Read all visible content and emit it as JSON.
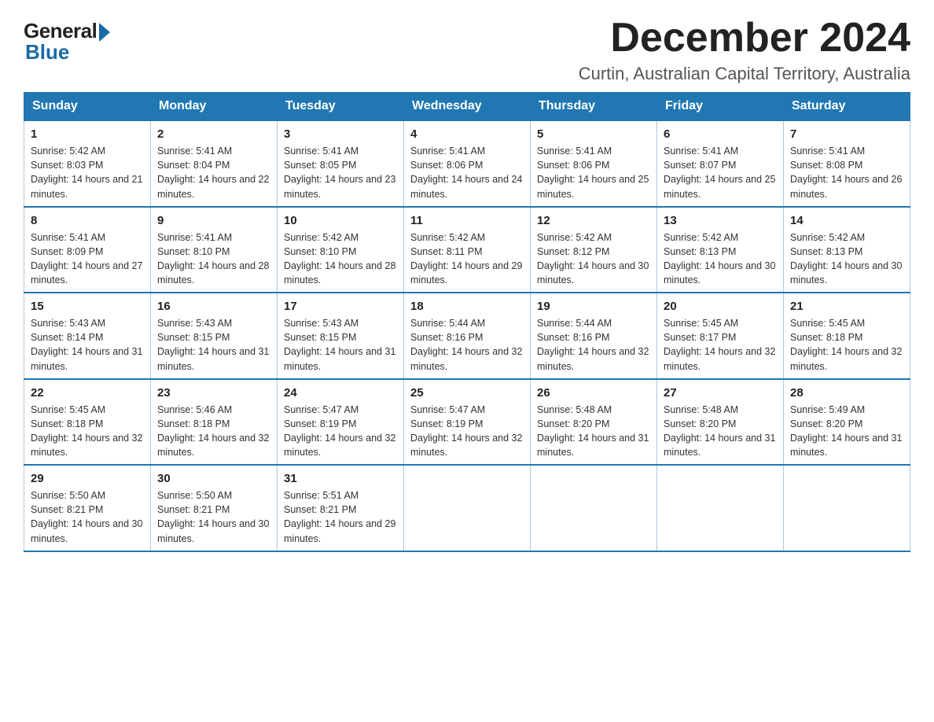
{
  "header": {
    "logo_general": "General",
    "logo_blue": "Blue",
    "month_title": "December 2024",
    "location": "Curtin, Australian Capital Territory, Australia"
  },
  "columns": [
    "Sunday",
    "Monday",
    "Tuesday",
    "Wednesday",
    "Thursday",
    "Friday",
    "Saturday"
  ],
  "weeks": [
    [
      {
        "day": "1",
        "sunrise": "Sunrise: 5:42 AM",
        "sunset": "Sunset: 8:03 PM",
        "daylight": "Daylight: 14 hours and 21 minutes."
      },
      {
        "day": "2",
        "sunrise": "Sunrise: 5:41 AM",
        "sunset": "Sunset: 8:04 PM",
        "daylight": "Daylight: 14 hours and 22 minutes."
      },
      {
        "day": "3",
        "sunrise": "Sunrise: 5:41 AM",
        "sunset": "Sunset: 8:05 PM",
        "daylight": "Daylight: 14 hours and 23 minutes."
      },
      {
        "day": "4",
        "sunrise": "Sunrise: 5:41 AM",
        "sunset": "Sunset: 8:06 PM",
        "daylight": "Daylight: 14 hours and 24 minutes."
      },
      {
        "day": "5",
        "sunrise": "Sunrise: 5:41 AM",
        "sunset": "Sunset: 8:06 PM",
        "daylight": "Daylight: 14 hours and 25 minutes."
      },
      {
        "day": "6",
        "sunrise": "Sunrise: 5:41 AM",
        "sunset": "Sunset: 8:07 PM",
        "daylight": "Daylight: 14 hours and 25 minutes."
      },
      {
        "day": "7",
        "sunrise": "Sunrise: 5:41 AM",
        "sunset": "Sunset: 8:08 PM",
        "daylight": "Daylight: 14 hours and 26 minutes."
      }
    ],
    [
      {
        "day": "8",
        "sunrise": "Sunrise: 5:41 AM",
        "sunset": "Sunset: 8:09 PM",
        "daylight": "Daylight: 14 hours and 27 minutes."
      },
      {
        "day": "9",
        "sunrise": "Sunrise: 5:41 AM",
        "sunset": "Sunset: 8:10 PM",
        "daylight": "Daylight: 14 hours and 28 minutes."
      },
      {
        "day": "10",
        "sunrise": "Sunrise: 5:42 AM",
        "sunset": "Sunset: 8:10 PM",
        "daylight": "Daylight: 14 hours and 28 minutes."
      },
      {
        "day": "11",
        "sunrise": "Sunrise: 5:42 AM",
        "sunset": "Sunset: 8:11 PM",
        "daylight": "Daylight: 14 hours and 29 minutes."
      },
      {
        "day": "12",
        "sunrise": "Sunrise: 5:42 AM",
        "sunset": "Sunset: 8:12 PM",
        "daylight": "Daylight: 14 hours and 30 minutes."
      },
      {
        "day": "13",
        "sunrise": "Sunrise: 5:42 AM",
        "sunset": "Sunset: 8:13 PM",
        "daylight": "Daylight: 14 hours and 30 minutes."
      },
      {
        "day": "14",
        "sunrise": "Sunrise: 5:42 AM",
        "sunset": "Sunset: 8:13 PM",
        "daylight": "Daylight: 14 hours and 30 minutes."
      }
    ],
    [
      {
        "day": "15",
        "sunrise": "Sunrise: 5:43 AM",
        "sunset": "Sunset: 8:14 PM",
        "daylight": "Daylight: 14 hours and 31 minutes."
      },
      {
        "day": "16",
        "sunrise": "Sunrise: 5:43 AM",
        "sunset": "Sunset: 8:15 PM",
        "daylight": "Daylight: 14 hours and 31 minutes."
      },
      {
        "day": "17",
        "sunrise": "Sunrise: 5:43 AM",
        "sunset": "Sunset: 8:15 PM",
        "daylight": "Daylight: 14 hours and 31 minutes."
      },
      {
        "day": "18",
        "sunrise": "Sunrise: 5:44 AM",
        "sunset": "Sunset: 8:16 PM",
        "daylight": "Daylight: 14 hours and 32 minutes."
      },
      {
        "day": "19",
        "sunrise": "Sunrise: 5:44 AM",
        "sunset": "Sunset: 8:16 PM",
        "daylight": "Daylight: 14 hours and 32 minutes."
      },
      {
        "day": "20",
        "sunrise": "Sunrise: 5:45 AM",
        "sunset": "Sunset: 8:17 PM",
        "daylight": "Daylight: 14 hours and 32 minutes."
      },
      {
        "day": "21",
        "sunrise": "Sunrise: 5:45 AM",
        "sunset": "Sunset: 8:18 PM",
        "daylight": "Daylight: 14 hours and 32 minutes."
      }
    ],
    [
      {
        "day": "22",
        "sunrise": "Sunrise: 5:45 AM",
        "sunset": "Sunset: 8:18 PM",
        "daylight": "Daylight: 14 hours and 32 minutes."
      },
      {
        "day": "23",
        "sunrise": "Sunrise: 5:46 AM",
        "sunset": "Sunset: 8:18 PM",
        "daylight": "Daylight: 14 hours and 32 minutes."
      },
      {
        "day": "24",
        "sunrise": "Sunrise: 5:47 AM",
        "sunset": "Sunset: 8:19 PM",
        "daylight": "Daylight: 14 hours and 32 minutes."
      },
      {
        "day": "25",
        "sunrise": "Sunrise: 5:47 AM",
        "sunset": "Sunset: 8:19 PM",
        "daylight": "Daylight: 14 hours and 32 minutes."
      },
      {
        "day": "26",
        "sunrise": "Sunrise: 5:48 AM",
        "sunset": "Sunset: 8:20 PM",
        "daylight": "Daylight: 14 hours and 31 minutes."
      },
      {
        "day": "27",
        "sunrise": "Sunrise: 5:48 AM",
        "sunset": "Sunset: 8:20 PM",
        "daylight": "Daylight: 14 hours and 31 minutes."
      },
      {
        "day": "28",
        "sunrise": "Sunrise: 5:49 AM",
        "sunset": "Sunset: 8:20 PM",
        "daylight": "Daylight: 14 hours and 31 minutes."
      }
    ],
    [
      {
        "day": "29",
        "sunrise": "Sunrise: 5:50 AM",
        "sunset": "Sunset: 8:21 PM",
        "daylight": "Daylight: 14 hours and 30 minutes."
      },
      {
        "day": "30",
        "sunrise": "Sunrise: 5:50 AM",
        "sunset": "Sunset: 8:21 PM",
        "daylight": "Daylight: 14 hours and 30 minutes."
      },
      {
        "day": "31",
        "sunrise": "Sunrise: 5:51 AM",
        "sunset": "Sunset: 8:21 PM",
        "daylight": "Daylight: 14 hours and 29 minutes."
      },
      {
        "day": "",
        "sunrise": "",
        "sunset": "",
        "daylight": ""
      },
      {
        "day": "",
        "sunrise": "",
        "sunset": "",
        "daylight": ""
      },
      {
        "day": "",
        "sunrise": "",
        "sunset": "",
        "daylight": ""
      },
      {
        "day": "",
        "sunrise": "",
        "sunset": "",
        "daylight": ""
      }
    ]
  ]
}
